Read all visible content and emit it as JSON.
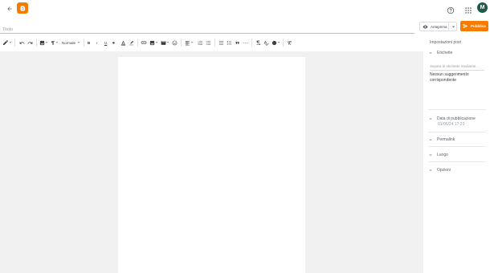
{
  "header": {
    "back_icon": "arrow-left-icon",
    "logo_icon": "blogger-logo",
    "help_icon": "help-circle-icon",
    "apps_icon": "apps-grid-icon",
    "avatar_initial": "M",
    "avatar_color": "#1e5b4a",
    "brand_color": "#f57c00"
  },
  "editor": {
    "title_placeholder": "Titolo",
    "format_select": "Normale"
  },
  "actions": {
    "preview_label": "Anteprima",
    "publish_label": "Pubblica"
  },
  "sidebar": {
    "title": "Impostazioni post",
    "labels": {
      "heading": "Etichette",
      "placeholder": "Separa le etichette mediante…",
      "no_match": "Nessun suggerimento corrispondente"
    },
    "publish_date": {
      "heading": "Data di pubblicazione",
      "value": "01/05/24 17:23"
    },
    "permalink": {
      "heading": "Permalink"
    },
    "location": {
      "heading": "Luogo"
    },
    "options": {
      "heading": "Opzioni"
    }
  }
}
